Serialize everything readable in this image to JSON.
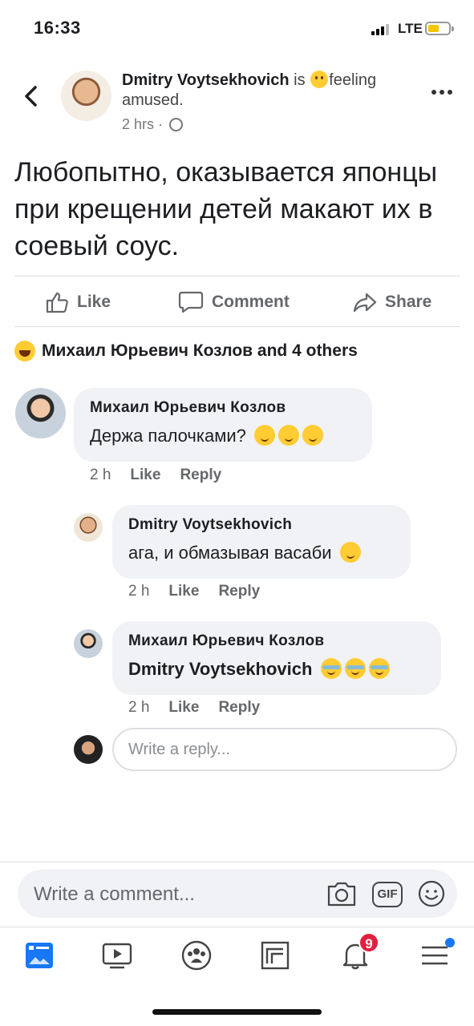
{
  "status_bar": {
    "time": "16:33",
    "network": "LTE"
  },
  "post": {
    "author": "Dmitry  Voytsekhovich",
    "is_word": "is",
    "feeling_text": "feeling amused.",
    "time": "2 hrs",
    "separator": "·",
    "text": "Любопытно, оказывается японцы при крещении детей макают их в соевый соус."
  },
  "actions": {
    "like": "Like",
    "comment": "Comment",
    "share": "Share"
  },
  "reactions": {
    "summary": "Михаил Юрьевич Козлов and 4 others"
  },
  "comments": [
    {
      "author": "Михаил Юрьевич Козлов",
      "text": "Держа палочками?",
      "emoji": [
        "thinking-emoji",
        "wink-emoji",
        "smile-emoji"
      ],
      "time": "2 h",
      "like": "Like",
      "reply": "Reply"
    },
    {
      "author": "Dmitry  Voytsekhovich",
      "text": "ага, и обмазывая васаби",
      "emoji": [
        "slight-smile-emoji"
      ],
      "time": "2 h",
      "like": "Like",
      "reply": "Reply"
    },
    {
      "author": "Михаил Юрьевич Козлов",
      "text": "Dmitry  Voytsekhovich",
      "emoji": [
        "tears-of-joy-emoji",
        "tears-of-joy-emoji",
        "tears-of-joy-emoji"
      ],
      "time": "2 h",
      "like": "Like",
      "reply": "Reply"
    }
  ],
  "reply_input": {
    "placeholder": "Write a reply..."
  },
  "comment_input": {
    "placeholder": "Write a comment...",
    "gif": "GIF"
  },
  "tab_bar": {
    "notifications_badge": "9"
  },
  "colors": {
    "accent": "#1877f2",
    "badge": "#e41e3f",
    "bubble": "#f0f2f5",
    "muted": "#65676b"
  }
}
